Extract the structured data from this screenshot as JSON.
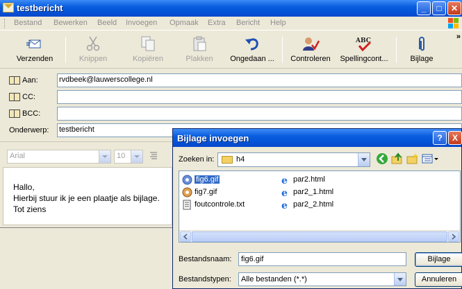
{
  "window": {
    "title": "testbericht"
  },
  "menu": [
    "Bestand",
    "Bewerken",
    "Beeld",
    "Invoegen",
    "Opmaak",
    "Extra",
    "Bericht",
    "Help"
  ],
  "toolbar": {
    "buttons": [
      {
        "label": "Verzenden",
        "icon": "send-icon",
        "enabled": true
      },
      {
        "label": "Knippen",
        "icon": "scissors-icon",
        "enabled": false
      },
      {
        "label": "Kopiëren",
        "icon": "copy-icon",
        "enabled": false
      },
      {
        "label": "Plakken",
        "icon": "paste-icon",
        "enabled": false
      },
      {
        "label": "Ongedaan ...",
        "icon": "undo-icon",
        "enabled": true
      },
      {
        "label": "Controleren",
        "icon": "check-names-icon",
        "enabled": true
      },
      {
        "label": "Spellingcont...",
        "icon": "spelling-icon",
        "enabled": true
      },
      {
        "label": "Bijlage",
        "icon": "paperclip-icon",
        "enabled": true
      }
    ],
    "overflow": "»"
  },
  "fields": {
    "to_label": "Aan:",
    "to_value": "rvdbeek@lauwerscollege.nl",
    "cc_label": "CC:",
    "cc_value": "",
    "bcc_label": "BCC:",
    "bcc_value": "",
    "subject_label": "Onderwerp:",
    "subject_value": "testbericht"
  },
  "format": {
    "font": "Arial",
    "size": "10"
  },
  "body": {
    "line1": "Hallo,",
    "line2": "Hierbij stuur ik je een plaatje als bijlage.",
    "line3": "Tot ziens"
  },
  "dialog": {
    "title": "Bijlage invoegen",
    "help": "?",
    "close": "X",
    "look_in_label": "Zoeken in:",
    "look_in_value": "h4",
    "files": [
      {
        "name": "fig6.gif",
        "type": "gif",
        "selected": true
      },
      {
        "name": "fig7.gif",
        "type": "gif",
        "selected": false
      },
      {
        "name": "foutcontrole.txt",
        "type": "txt",
        "selected": false
      },
      {
        "name": "par2.html",
        "type": "html",
        "selected": false
      },
      {
        "name": "par2_1.html",
        "type": "html",
        "selected": false
      },
      {
        "name": "par2_2.html",
        "type": "html",
        "selected": false
      }
    ],
    "filename_label": "Bestandsnaam:",
    "filename_value": "fig6.gif",
    "filetype_label": "Bestandstypen:",
    "filetype_value": "Alle bestanden (*.*)",
    "attach_button": "Bijlage",
    "cancel_button": "Annuleren"
  },
  "colors": {
    "titlebar": "#0a5ede",
    "selection": "#316ac5",
    "face": "#ece9d8"
  }
}
